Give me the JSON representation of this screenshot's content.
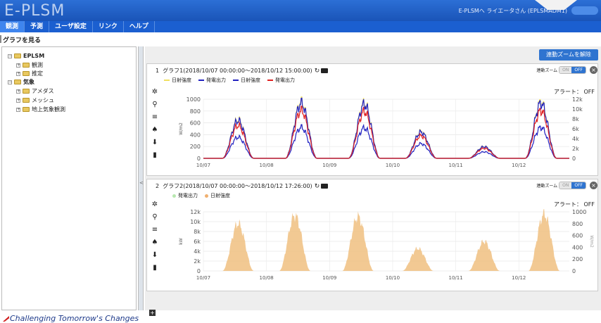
{
  "app": {
    "title": "E-PLSM",
    "user_info": "E-PLSMへ ライエータさん (EPLSMADM1)",
    "logout_label": ""
  },
  "menu": [
    {
      "label": "観測"
    },
    {
      "label": "予測"
    },
    {
      "label": "ユーザ設定"
    },
    {
      "label": "リンク"
    },
    {
      "label": "ヘルプ"
    }
  ],
  "breadcrumb": "グラフを見る",
  "tree": [
    {
      "label": "EPLSM",
      "level": 0,
      "bold": true
    },
    {
      "label": "観測",
      "level": 1
    },
    {
      "label": "推定",
      "level": 1
    },
    {
      "label": "気象",
      "level": 0,
      "bold": true
    },
    {
      "label": "アメダス",
      "level": 1
    },
    {
      "label": "メッシュ",
      "level": 1
    },
    {
      "label": "地上気象観測",
      "level": 1
    }
  ],
  "unzoom_label": "連動ズームを解除",
  "zoom_label": "連動ズーム",
  "on_label": "ON",
  "off_label": "OFF",
  "alert_label": "アラート： OFF",
  "graph1": {
    "number": "1",
    "title": "グラフ1(2018/10/07 00:00:00〜2018/10/12 15:00:00)",
    "legend": [
      {
        "name": "日射強度",
        "color": "#f0e060"
      },
      {
        "name": "発電出力",
        "color": "#2020c0"
      },
      {
        "name": "日射強度",
        "color": "#2020c0"
      },
      {
        "name": "発電出力",
        "color": "#e02020"
      }
    ]
  },
  "graph2": {
    "number": "2",
    "title": "グラフ2(2018/10/07 00:00:00〜2018/10/12 17:26:00)",
    "legend": [
      {
        "name": "発電出力",
        "color": "#b8e8b0"
      },
      {
        "name": "日射強度",
        "color": "#f0b070"
      }
    ]
  },
  "tagline": "Challenging Tomorrow's Changes",
  "chart_data": [
    {
      "type": "line",
      "title": "グラフ1(2018/10/07 00:00:00〜2018/10/12 15:00:00)",
      "x_ticks": [
        "10/07",
        "10/08",
        "10/09",
        "10/10",
        "10/11",
        "10/12"
      ],
      "y_left_ticks": [
        "0",
        "200",
        "400",
        "600",
        "800",
        "1000"
      ],
      "ylabel_left": "W/m2",
      "ylim_left": [
        0,
        1000
      ],
      "y_right_ticks": [
        "0",
        "2k",
        "4k",
        "6k",
        "8k",
        "10k",
        "12k"
      ],
      "ylim_right": [
        0,
        12000
      ],
      "day_peaks": [
        {
          "day": 0.55,
          "peak": 650
        },
        {
          "day": 1.55,
          "peak": 950
        },
        {
          "day": 2.55,
          "peak": 930
        },
        {
          "day": 3.45,
          "peak": 450
        },
        {
          "day": 4.45,
          "peak": 200
        },
        {
          "day": 5.35,
          "peak": 950
        }
      ],
      "series": [
        {
          "name": "日射強度",
          "color": "#f0e060",
          "scale": 1.0
        },
        {
          "name": "発電出力",
          "color": "#2020c0",
          "scale": 0.55
        },
        {
          "name": "日射強度",
          "color": "#2020c0",
          "scale": 0.98
        },
        {
          "name": "発電出力",
          "color": "#e02020",
          "scale": 0.85
        }
      ]
    },
    {
      "type": "area",
      "title": "グラフ2(2018/10/07 00:00:00〜2018/10/12 17:26:00)",
      "x_ticks": [
        "10/07",
        "10/08",
        "10/09",
        "10/10",
        "10/11",
        "10/12"
      ],
      "y_left_ticks": [
        "0",
        "2k",
        "4k",
        "6k",
        "8k",
        "10k",
        "12k"
      ],
      "ylabel_left": "kW",
      "ylim_left": [
        0,
        12000
      ],
      "y_right_ticks": [
        "0",
        "200",
        "400",
        "600",
        "800",
        "1000"
      ],
      "ylabel_right": "W/m2",
      "ylim_right": [
        0,
        1000
      ],
      "day_peaks": [
        {
          "day": 0.55,
          "peak": 800
        },
        {
          "day": 1.45,
          "peak": 940
        },
        {
          "day": 2.45,
          "peak": 920
        },
        {
          "day": 3.4,
          "peak": 380
        },
        {
          "day": 4.45,
          "peak": 500
        },
        {
          "day": 5.4,
          "peak": 960
        }
      ],
      "series": [
        {
          "name": "日射強度",
          "color": "#f0c080"
        }
      ]
    }
  ]
}
